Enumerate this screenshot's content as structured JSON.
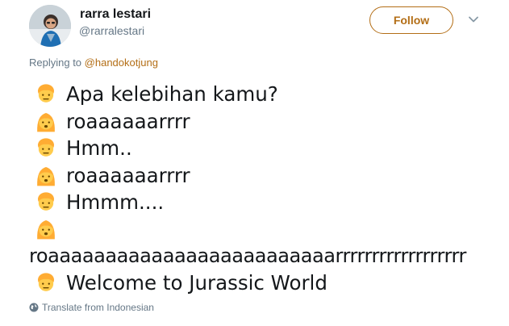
{
  "author": {
    "name": "rarra lestari",
    "handle": "@rarralestari",
    "avatar": "avatar-photo"
  },
  "follow_label": "Follow",
  "reply": {
    "prefix": "Replying to ",
    "target": "@handokotjung"
  },
  "lines": [
    {
      "icon": "man-emoji",
      "text": "Apa kelebihan kamu?"
    },
    {
      "icon": "woman-emoji",
      "text": "roaaaaaarrrr"
    },
    {
      "icon": "man-emoji",
      "text": "Hmm.."
    },
    {
      "icon": "woman-emoji",
      "text": "roaaaaaarrrr"
    },
    {
      "icon": "man-emoji",
      "text": "Hmmm...."
    },
    {
      "icon": "woman-emoji",
      "text": ""
    },
    {
      "icon": "",
      "text": "roaaaaaaaaaaaaaaaaaaaaaaaaarrrrrrrrrrrrrrrrrr"
    },
    {
      "icon": "man-emoji",
      "text": "Welcome to Jurassic World"
    }
  ],
  "translate_label": "Translate from Indonesian",
  "colors": {
    "accent": "#b36e16",
    "secondary_text": "#657786",
    "primary_text": "#14171a",
    "emoji_yellow": "#ffcc4d"
  }
}
